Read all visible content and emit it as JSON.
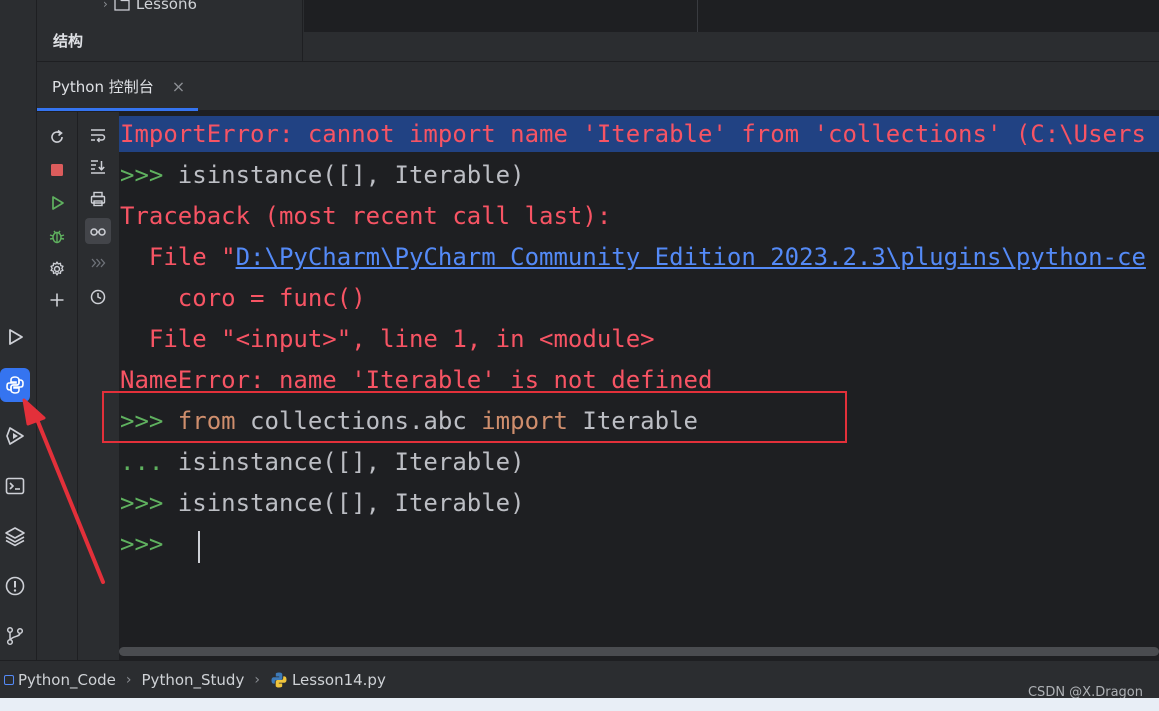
{
  "project_tree": {
    "folder": "Lesson6"
  },
  "structure_panel": {
    "title": "结构"
  },
  "console_tab": {
    "label": "Python 控制台",
    "close": "×"
  },
  "console": {
    "lines": [
      {
        "text": "ImportError: cannot import name 'Iterable' from 'collections' (C:\\Users"
      },
      {
        "prompt": ">>> ",
        "code": "isinstance([], Iterable)"
      },
      {
        "text": "Traceback (most recent call last):"
      },
      {
        "prefix": "  File \"",
        "link": "D:\\PyCharm\\PyCharm Community Edition 2023.2.3\\plugins\\python-ce"
      },
      {
        "text": "    coro = func()"
      },
      {
        "text": "  File \"<input>\", line 1, in <module>"
      },
      {
        "text": "NameError: name 'Iterable' is not defined"
      },
      {
        "prompt": ">>> ",
        "kw1": "from",
        "mid": " collections.abc ",
        "kw2": "import",
        "tail": " Iterable"
      },
      {
        "prompt": "... ",
        "code": "isinstance([], Iterable)"
      },
      {
        "prompt": ">>> ",
        "code": "isinstance([], Iterable)"
      },
      {
        "prompt": ">>> ",
        "code": ""
      }
    ]
  },
  "breadcrumbs": {
    "items": [
      "Python_Code",
      "Python_Study",
      "Lesson14.py"
    ],
    "separator": "›"
  },
  "watermark": "CSDN @X.Dragon",
  "colors": {
    "accent": "#3574f0",
    "error_text": "#f75464",
    "prompt": "#5fb15f",
    "keyword": "#cf8e6d",
    "link": "#548af7",
    "selection": "#214283",
    "annotation_red": "#e3303a"
  }
}
